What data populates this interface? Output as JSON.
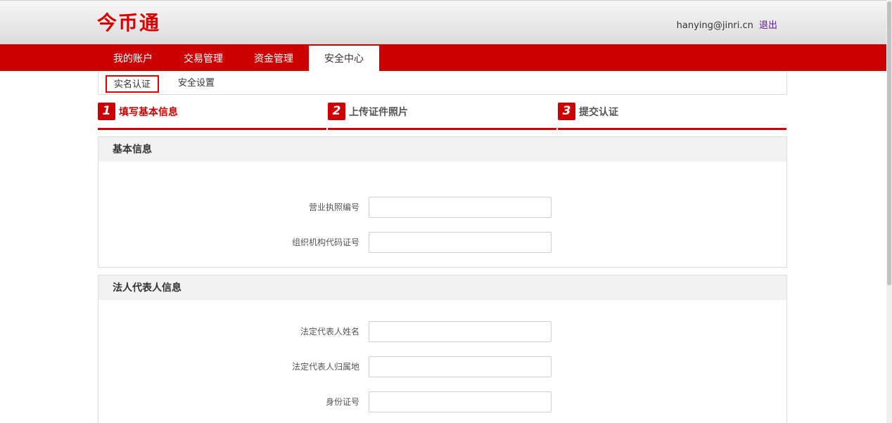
{
  "header": {
    "logo": "今币通",
    "user_email": "hanying@jinri.cn",
    "logout_label": "退出"
  },
  "nav": {
    "items": [
      "我的账户",
      "交易管理",
      "资金管理",
      "安全中心"
    ],
    "active": "安全中心"
  },
  "subnav": {
    "items": [
      "实名认证",
      "安全设置"
    ],
    "active": "实名认证"
  },
  "steps": [
    {
      "num": "1",
      "label": "填写基本信息",
      "current": true
    },
    {
      "num": "2",
      "label": "上传证件照片",
      "current": false
    },
    {
      "num": "3",
      "label": "提交认证",
      "current": false
    }
  ],
  "basic_info": {
    "title": "基本信息",
    "fields": [
      {
        "label": "营业执照编号",
        "value": ""
      },
      {
        "label": "组织机构代码证号",
        "value": ""
      }
    ]
  },
  "legal_rep": {
    "title": "法人代表人信息",
    "fields": [
      {
        "label": "法定代表人姓名",
        "value": ""
      },
      {
        "label": "法定代表人归属地",
        "value": ""
      },
      {
        "label": "身份证号",
        "value": ""
      }
    ]
  },
  "colors": {
    "brand_red": "#cc0000",
    "logout_link": "#5a1a8a"
  }
}
